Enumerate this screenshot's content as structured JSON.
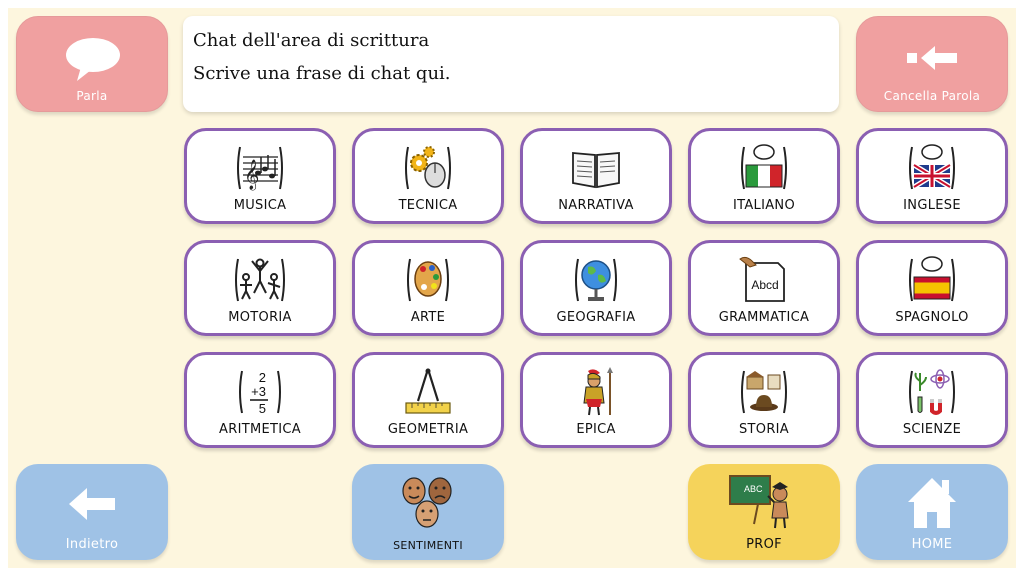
{
  "chat": {
    "line1": "Chat dell'area di scrittura",
    "line2": "Scrive una frase di chat qui."
  },
  "buttons": {
    "speak": "Parla",
    "delete_word": "Cancella Parola",
    "back": "Indietro",
    "feelings": "SENTIMENTI",
    "teacher": "PROF",
    "home": "HOME"
  },
  "subjects": [
    "MUSICA",
    "TECNICA",
    "NARRATIVA",
    "ITALIANO",
    "INGLESE",
    "MOTORIA",
    "ARTE",
    "GEOGRAFIA",
    "GRAMMATICA",
    "SPAGNOLO",
    "ARITMETICA",
    "GEOMETRIA",
    "EPICA",
    "STORIA",
    "SCIENZE"
  ],
  "icon_text": {
    "grammatica": "Abcd",
    "arith_a": "2",
    "arith_b": "+3",
    "arith_c": "5",
    "prof_board": "ABC"
  },
  "colors": {
    "category_border": "#8b5fb2",
    "red_button": "#f0a0a0",
    "blue_button": "#9fc2e6",
    "yellow_button": "#f5d35b",
    "background": "#fdf6de"
  }
}
